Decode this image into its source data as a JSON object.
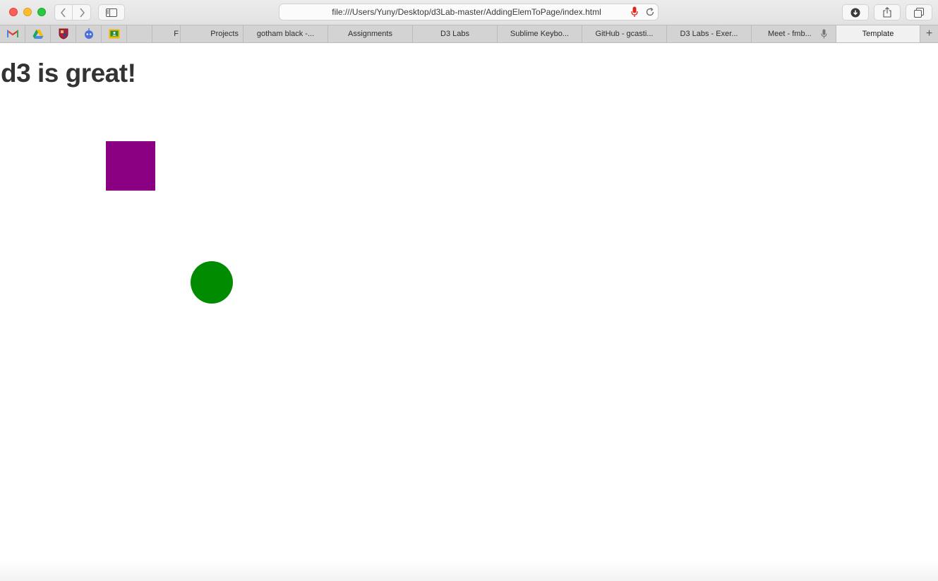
{
  "browser": {
    "url": "file:///Users/Yuny/Desktop/d3Lab-master/AddingElemToPage/index.html",
    "favorites": [
      "gmail-icon",
      "drive-icon",
      "shield-icon",
      "robot-icon",
      "classroom-icon"
    ],
    "tabs": [
      {
        "label": ""
      },
      {
        "label": "F"
      },
      {
        "label": "Projects"
      },
      {
        "label": "gotham black -..."
      },
      {
        "label": "Assignments"
      },
      {
        "label": "D3 Labs"
      },
      {
        "label": "Sublime Keybo..."
      },
      {
        "label": "GitHub - gcasti..."
      },
      {
        "label": "D3 Labs - Exer..."
      },
      {
        "label": "Meet - fmb..."
      },
      {
        "label": "Template"
      }
    ],
    "new_tab_symbol": "+"
  },
  "page": {
    "heading": "d3 is great!",
    "colors": {
      "rect": "#8b0083",
      "circle": "#008b00"
    }
  }
}
